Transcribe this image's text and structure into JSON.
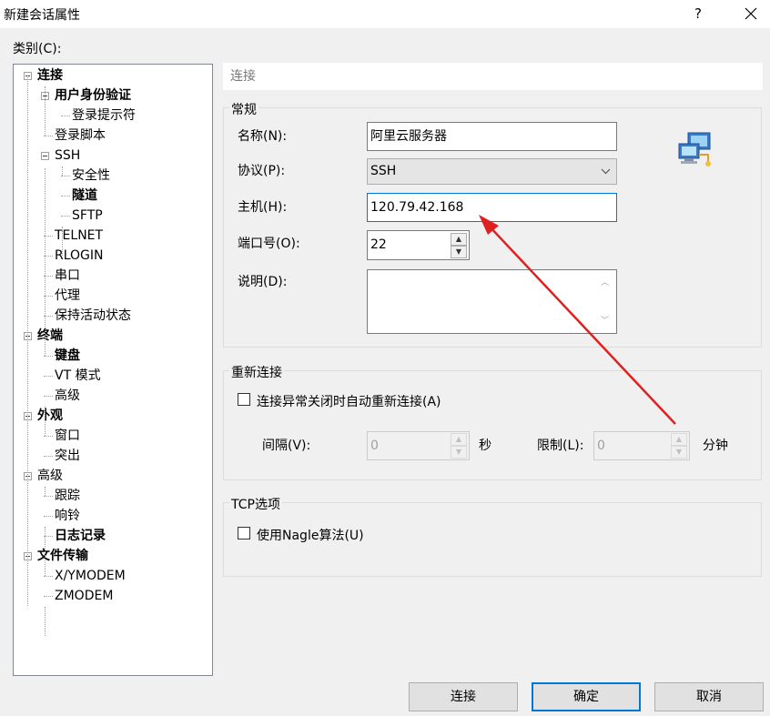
{
  "window": {
    "title": "新建会话属性",
    "help_label": "?"
  },
  "category_label": "类别(C):",
  "tree": [
    {
      "label": "连接",
      "bold": true,
      "name": "tree-item-connection"
    },
    {
      "label": "用户身份验证",
      "bold": true,
      "name": "tree-item-user-auth"
    },
    {
      "label": "登录提示符",
      "bold": false,
      "name": "tree-item-login-prompt"
    },
    {
      "label": "登录脚本",
      "bold": false,
      "name": "tree-item-login-script"
    },
    {
      "label": "SSH",
      "bold": false,
      "name": "tree-item-ssh"
    },
    {
      "label": "安全性",
      "bold": false,
      "name": "tree-item-security"
    },
    {
      "label": "隧道",
      "bold": true,
      "name": "tree-item-tunnel"
    },
    {
      "label": "SFTP",
      "bold": false,
      "name": "tree-item-sftp"
    },
    {
      "label": "TELNET",
      "bold": false,
      "name": "tree-item-telnet"
    },
    {
      "label": "RLOGIN",
      "bold": false,
      "name": "tree-item-rlogin"
    },
    {
      "label": "串口",
      "bold": false,
      "name": "tree-item-serial"
    },
    {
      "label": "代理",
      "bold": false,
      "name": "tree-item-proxy"
    },
    {
      "label": "保持活动状态",
      "bold": false,
      "name": "tree-item-keepalive"
    },
    {
      "label": "终端",
      "bold": true,
      "name": "tree-item-terminal"
    },
    {
      "label": "键盘",
      "bold": true,
      "name": "tree-item-keyboard"
    },
    {
      "label": "VT 模式",
      "bold": false,
      "name": "tree-item-vt-mode"
    },
    {
      "label": "高级",
      "bold": false,
      "name": "tree-item-terminal-advanced"
    },
    {
      "label": "外观",
      "bold": true,
      "name": "tree-item-appearance"
    },
    {
      "label": "窗口",
      "bold": false,
      "name": "tree-item-window"
    },
    {
      "label": "突出",
      "bold": false,
      "name": "tree-item-highlight"
    },
    {
      "label": "高级",
      "bold": false,
      "name": "tree-item-advanced"
    },
    {
      "label": "跟踪",
      "bold": false,
      "name": "tree-item-trace"
    },
    {
      "label": "响铃",
      "bold": false,
      "name": "tree-item-bell"
    },
    {
      "label": "日志记录",
      "bold": true,
      "name": "tree-item-logging"
    },
    {
      "label": "文件传输",
      "bold": true,
      "name": "tree-item-file-transfer"
    },
    {
      "label": "X/YMODEM",
      "bold": false,
      "name": "tree-item-xymodem"
    },
    {
      "label": "ZMODEM",
      "bold": false,
      "name": "tree-item-zmodem"
    }
  ],
  "panel_header": "连接",
  "general": {
    "title": "常规",
    "name_label": "名称(N):",
    "name_value": "阿里云服务器",
    "protocol_label": "协议(P):",
    "protocol_value": "SSH",
    "host_label": "主机(H):",
    "host_value": "120.79.42.168",
    "port_label": "端口号(O):",
    "port_value": "22",
    "desc_label": "说明(D):",
    "desc_value": ""
  },
  "reconnect": {
    "title": "重新连接",
    "auto_label": "连接异常关闭时自动重新连接(A)",
    "auto_checked": false,
    "interval_label": "间隔(V):",
    "interval_value": "0",
    "interval_unit": "秒",
    "limit_label": "限制(L):",
    "limit_value": "0",
    "limit_unit": "分钟"
  },
  "tcp": {
    "title": "TCP选项",
    "nagle_label": "使用Nagle算法(U)",
    "nagle_checked": false
  },
  "buttons": {
    "connect": "连接",
    "ok": "确定",
    "cancel": "取消"
  },
  "colors": {
    "focus_border": "#0078d7",
    "arrow": "#e02020"
  }
}
